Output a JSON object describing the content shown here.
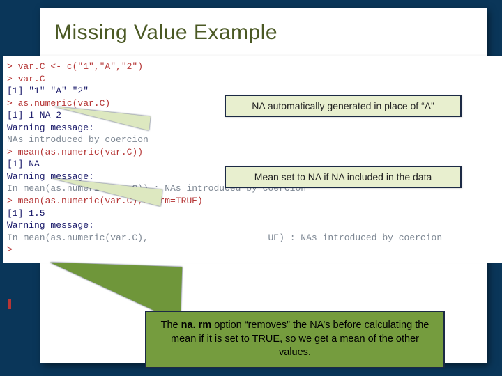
{
  "slide": {
    "title": "Missing Value Example"
  },
  "console": {
    "l1": "> var.C <- c(\"1\",\"A\",\"2\")",
    "l2": "> var.C",
    "l3": "[1] \"1\" \"A\" \"2\"",
    "l4": "> as.numeric(var.C)",
    "l5": "[1]  1 NA  2",
    "l6": "Warning message:",
    "l7": "NAs introduced by coercion",
    "l8": "> mean(as.numeric(var.C))",
    "l9": "[1] NA",
    "l10": "Warning message:",
    "l11": "In mean(as.numeric(var.C)) : NAs introduced by coercion",
    "l12": "> mean(as.numeric(var.C),na.rm=TRUE)",
    "l13": "[1] 1.5",
    "l14": "Warning message:",
    "l15a": "In mean(as.numeric(var.C),",
    "l15b": "UE) : NAs introduced by coercion",
    "l16": "> "
  },
  "callouts": {
    "c1": "NA automatically generated in place of “A”",
    "c2": "Mean set to NA if NA included in the data",
    "c3_prefix": "The ",
    "c3_bold": "na. rm",
    "c3_rest": " option “removes” the NA’s before calculating the mean if it is set to TRUE, so we get a mean of the other values."
  }
}
